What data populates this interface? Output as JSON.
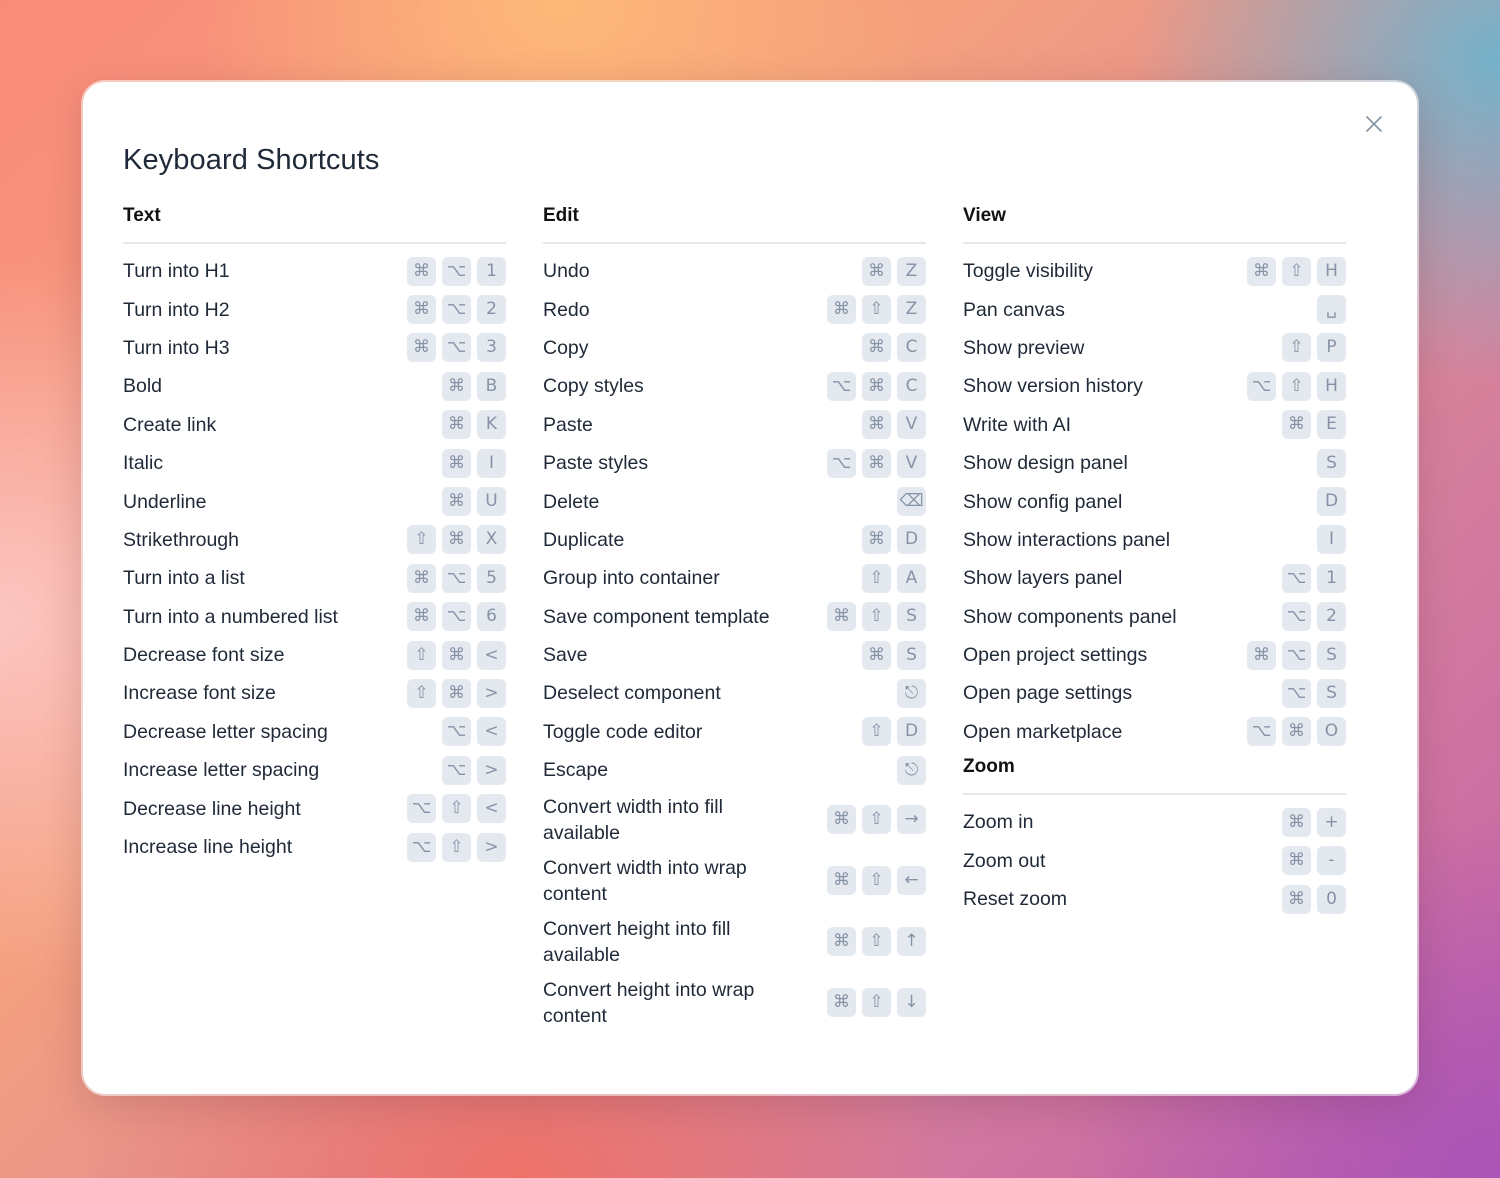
{
  "dialog": {
    "title": "Keyboard Shortcuts",
    "close_icon": "close-icon"
  },
  "sections": {
    "text": {
      "title": "Text",
      "items": [
        {
          "label": "Turn into H1",
          "keys": [
            "⌘",
            "⌥",
            "1"
          ]
        },
        {
          "label": "Turn into H2",
          "keys": [
            "⌘",
            "⌥",
            "2"
          ]
        },
        {
          "label": "Turn into H3",
          "keys": [
            "⌘",
            "⌥",
            "3"
          ]
        },
        {
          "label": "Bold",
          "keys": [
            "⌘",
            "B"
          ]
        },
        {
          "label": "Create link",
          "keys": [
            "⌘",
            "K"
          ]
        },
        {
          "label": "Italic",
          "keys": [
            "⌘",
            "I"
          ]
        },
        {
          "label": "Underline",
          "keys": [
            "⌘",
            "U"
          ]
        },
        {
          "label": "Strikethrough",
          "keys": [
            "⇧",
            "⌘",
            "X"
          ]
        },
        {
          "label": "Turn into a list",
          "keys": [
            "⌘",
            "⌥",
            "5"
          ]
        },
        {
          "label": "Turn into a numbered list",
          "keys": [
            "⌘",
            "⌥",
            "6"
          ]
        },
        {
          "label": "Decrease font size",
          "keys": [
            "⇧",
            "⌘",
            "<"
          ]
        },
        {
          "label": "Increase font size",
          "keys": [
            "⇧",
            "⌘",
            ">"
          ]
        },
        {
          "label": "Decrease letter spacing",
          "keys": [
            "⌥",
            "<"
          ]
        },
        {
          "label": "Increase letter spacing",
          "keys": [
            "⌥",
            ">"
          ]
        },
        {
          "label": "Decrease line height",
          "keys": [
            "⌥",
            "⇧",
            "<"
          ]
        },
        {
          "label": "Increase line height",
          "keys": [
            "⌥",
            "⇧",
            ">"
          ]
        }
      ]
    },
    "edit": {
      "title": "Edit",
      "items": [
        {
          "label": "Undo",
          "keys": [
            "⌘",
            "Z"
          ]
        },
        {
          "label": "Redo",
          "keys": [
            "⌘",
            "⇧",
            "Z"
          ]
        },
        {
          "label": "Copy",
          "keys": [
            "⌘",
            "C"
          ]
        },
        {
          "label": "Copy styles",
          "keys": [
            "⌥",
            "⌘",
            "C"
          ]
        },
        {
          "label": "Paste",
          "keys": [
            "⌘",
            "V"
          ]
        },
        {
          "label": "Paste styles",
          "keys": [
            "⌥",
            "⌘",
            "V"
          ]
        },
        {
          "label": "Delete",
          "keys": [
            "⌫"
          ]
        },
        {
          "label": "Duplicate",
          "keys": [
            "⌘",
            "D"
          ]
        },
        {
          "label": "Group into container",
          "keys": [
            "⇧",
            "A"
          ]
        },
        {
          "label": "Save component template",
          "keys": [
            "⌘",
            "⇧",
            "S"
          ]
        },
        {
          "label": "Save",
          "keys": [
            "⌘",
            "S"
          ]
        },
        {
          "label": "Deselect component",
          "keys": [
            "⎋"
          ]
        },
        {
          "label": "Toggle code editor",
          "keys": [
            "⇧",
            "D"
          ]
        },
        {
          "label": "Escape",
          "keys": [
            "⎋"
          ]
        },
        {
          "label": "Convert width into fill available",
          "keys": [
            "⌘",
            "⇧",
            "→"
          ]
        },
        {
          "label": "Convert width into wrap content",
          "keys": [
            "⌘",
            "⇧",
            "←"
          ]
        },
        {
          "label": "Convert height into fill available",
          "keys": [
            "⌘",
            "⇧",
            "↑"
          ]
        },
        {
          "label": "Convert height into wrap content",
          "keys": [
            "⌘",
            "⇧",
            "↓"
          ]
        }
      ]
    },
    "view": {
      "title": "View",
      "items": [
        {
          "label": "Toggle visibility",
          "keys": [
            "⌘",
            "⇧",
            "H"
          ]
        },
        {
          "label": "Pan canvas",
          "keys": [
            "␣"
          ]
        },
        {
          "label": "Show preview",
          "keys": [
            "⇧",
            "P"
          ]
        },
        {
          "label": "Show version history",
          "keys": [
            "⌥",
            "⇧",
            "H"
          ]
        },
        {
          "label": "Write with AI",
          "keys": [
            "⌘",
            "E"
          ]
        },
        {
          "label": "Show design panel",
          "keys": [
            "S"
          ]
        },
        {
          "label": "Show config panel",
          "keys": [
            "D"
          ]
        },
        {
          "label": "Show interactions panel",
          "keys": [
            "I"
          ]
        },
        {
          "label": "Show layers panel",
          "keys": [
            "⌥",
            "1"
          ]
        },
        {
          "label": "Show components panel",
          "keys": [
            "⌥",
            "2"
          ]
        },
        {
          "label": "Open project settings",
          "keys": [
            "⌘",
            "⌥",
            "S"
          ]
        },
        {
          "label": "Open page settings",
          "keys": [
            "⌥",
            "S"
          ]
        },
        {
          "label": "Open marketplace",
          "keys": [
            "⌥",
            "⌘",
            "O"
          ]
        }
      ]
    },
    "zoom": {
      "title": "Zoom",
      "items": [
        {
          "label": "Zoom in",
          "keys": [
            "⌘",
            "+"
          ]
        },
        {
          "label": "Zoom out",
          "keys": [
            "⌘",
            "-"
          ]
        },
        {
          "label": "Reset zoom",
          "keys": [
            "⌘",
            "0"
          ]
        }
      ]
    }
  },
  "colors": {
    "key_bg": "#e4e8ef",
    "key_fg": "#8693a6",
    "text": "#1f2937"
  }
}
